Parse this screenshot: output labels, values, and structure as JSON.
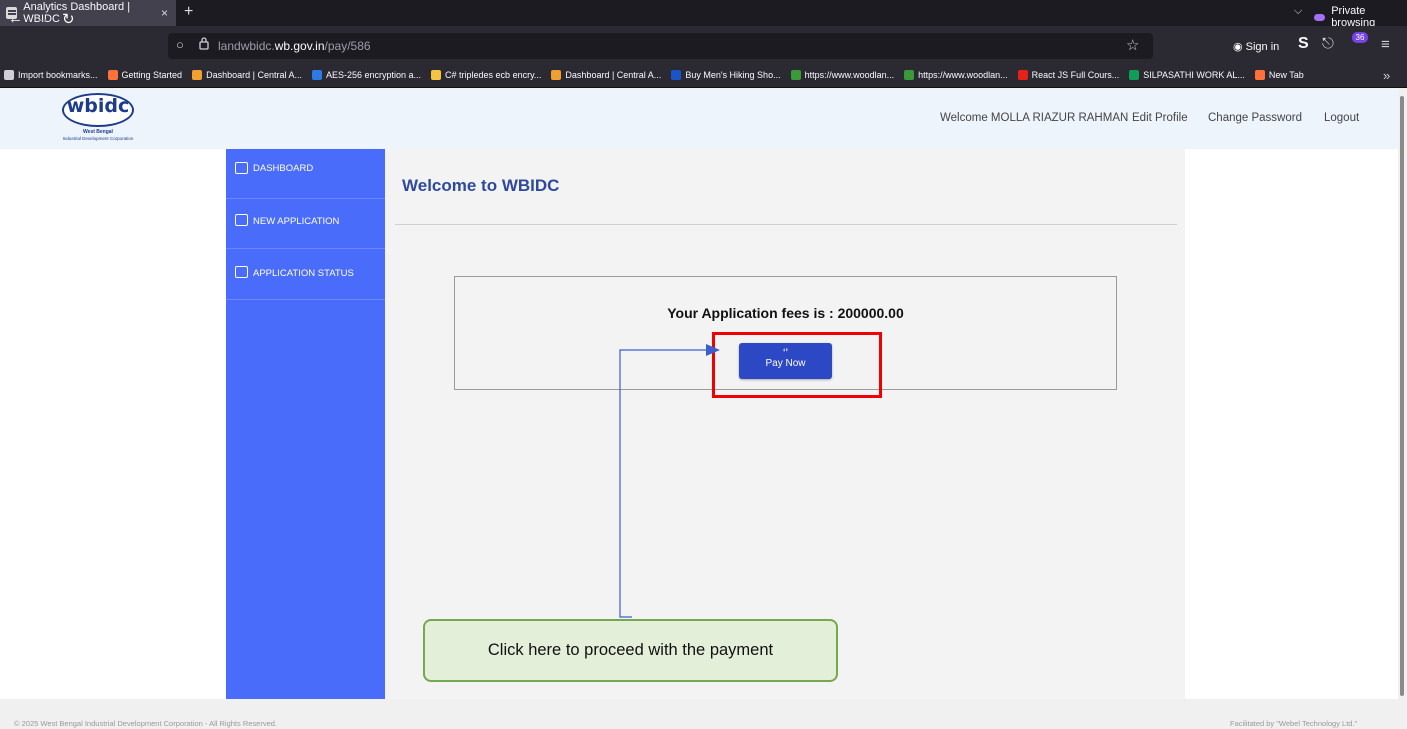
{
  "browser": {
    "tab_title": "Analytics Dashboard | WBIDC",
    "tab_close": "×",
    "new_tab": "+",
    "tab_list": "⌵",
    "private_label": "Private browsing",
    "back": "←",
    "forward": "→",
    "reload": "↻",
    "url_domain_prefix": "landwbidc.",
    "url_domain_main": "wb.gov.in",
    "url_path": "/pay/586",
    "sign_in": "Sign in",
    "ext_s": "S",
    "ext_badge": "36",
    "menu": "≡",
    "bookmarks": [
      {
        "label": "Import bookmarks...",
        "color": "#cfcfd8"
      },
      {
        "label": "Getting Started",
        "color": "#ff7139"
      },
      {
        "label": "Dashboard | Central A...",
        "color": "#f0a030"
      },
      {
        "label": "AES-256 encryption a...",
        "color": "#2c7be5"
      },
      {
        "label": "C# tripledes ecb encry...",
        "color": "#f4c542"
      },
      {
        "label": "Dashboard | Central A...",
        "color": "#f0a030"
      },
      {
        "label": "Buy Men's Hiking Sho...",
        "color": "#1a55c8"
      },
      {
        "label": "https://www.woodlan...",
        "color": "#3a9a3a"
      },
      {
        "label": "https://www.woodlan...",
        "color": "#3a9a3a"
      },
      {
        "label": "React JS Full Cours...",
        "color": "#e62117"
      },
      {
        "label": "SILPASATHI WORK AL...",
        "color": "#0f9d58"
      },
      {
        "label": "New Tab",
        "color": "#ff7139"
      }
    ],
    "bookmarks_more": "»"
  },
  "header": {
    "logo_word": "wbidc",
    "logo_sub1": "West Bengal",
    "logo_sub2": "Industrial Development Corporation",
    "welcome_user": "Welcome MOLLA RIAZUR RAHMAN",
    "edit_profile": "Edit Profile",
    "change_password": "Change Password",
    "logout": "Logout"
  },
  "sidebar": {
    "items": [
      {
        "label": "DASHBOARD"
      },
      {
        "label": "NEW APPLICATION"
      },
      {
        "label": "APPLICATION STATUS"
      }
    ]
  },
  "main": {
    "welcome_title": "Welcome to WBIDC",
    "fee_text": "Your Application fees is : 200000.00",
    "pay_icon": "‘’",
    "pay_button": "Pay Now"
  },
  "annotation": {
    "callout_text": "Click here to proceed with the payment"
  },
  "footer": {
    "left": "© 2025 West Bengal Industrial Development Corporation - All Rights Reserved.",
    "right": "Facilitated by \"Webel Technology Ltd.\""
  },
  "colors": {
    "sidebar": "#4a6cfa",
    "pay_button": "#2d48c4",
    "highlight": "#f00000",
    "callout_bg": "#e3efd9",
    "callout_border": "#76a850",
    "title": "#2f4a9c"
  }
}
